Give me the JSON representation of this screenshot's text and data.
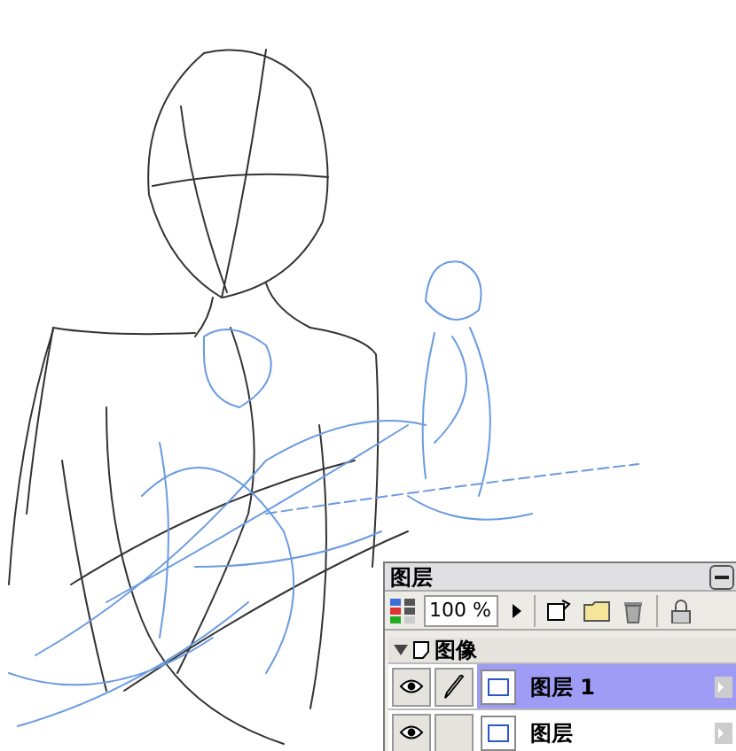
{
  "layers_panel": {
    "title": "图层",
    "opacity": "100 %",
    "groups": [
      {
        "name": "图像",
        "expanded": true,
        "layers": [
          {
            "name": "图层 1",
            "selected": true,
            "visible": true,
            "editable": true
          },
          {
            "name": "图层",
            "selected": false,
            "visible": true,
            "editable": false
          }
        ]
      }
    ]
  }
}
